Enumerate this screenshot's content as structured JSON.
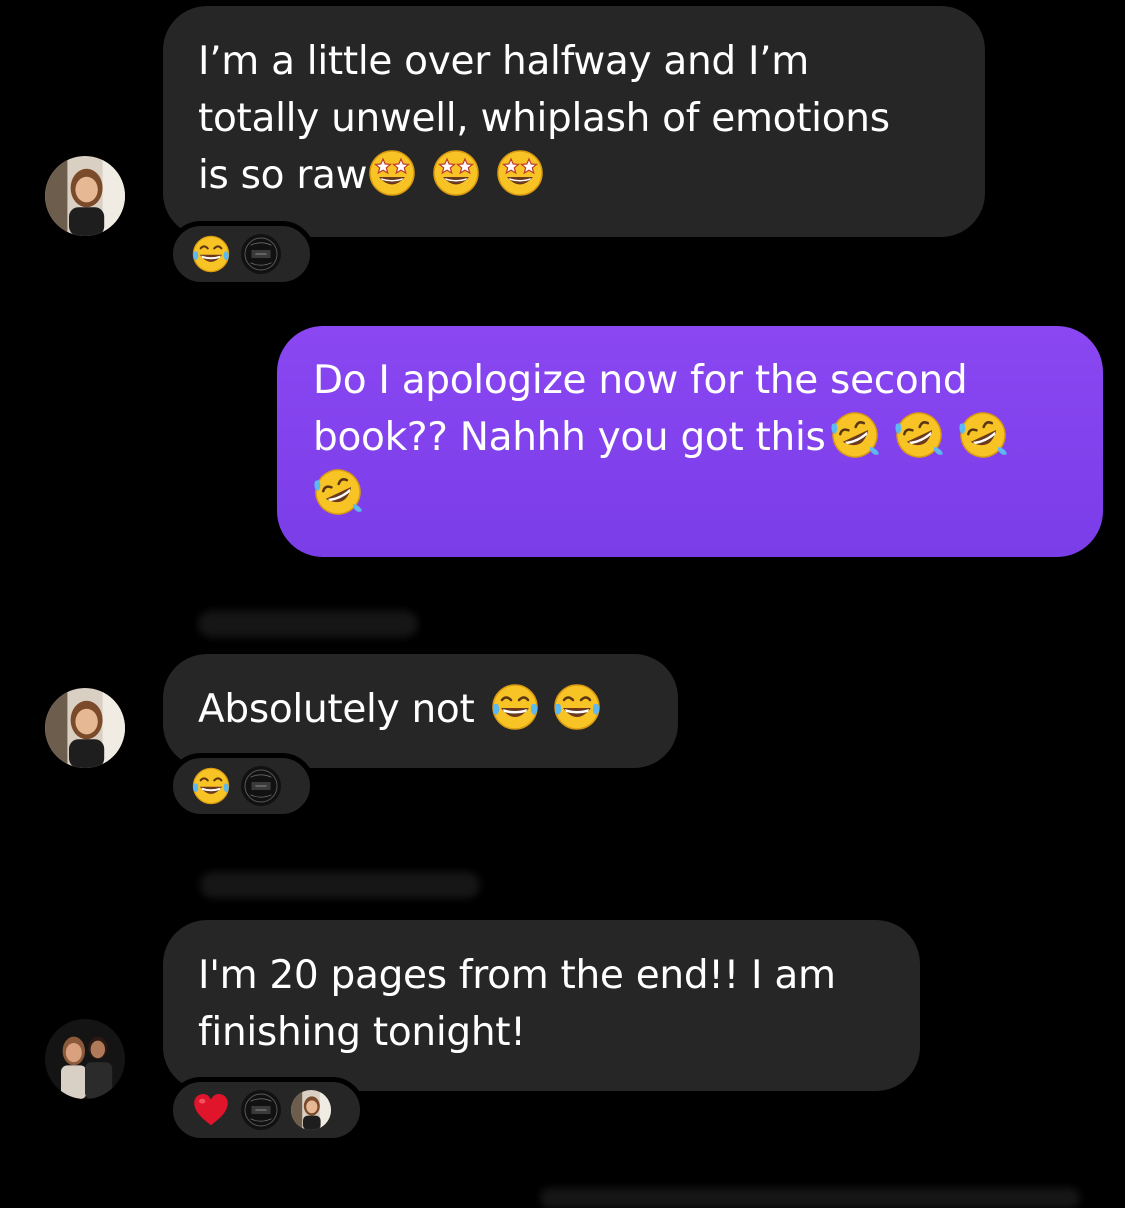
{
  "messages": [
    {
      "sender": "them",
      "text": "I’m a little over halfway and I’m totally unwell, whiplash of emotions is so raw",
      "lines": [
        "I’m a little over halfway and I’m",
        "totally unwell, whiplash of emotions",
        "is so raw"
      ],
      "trailing_emoji": [
        "star-struck",
        "star-struck",
        "star-struck"
      ],
      "reactions": [
        "laughing-tears",
        "profile-photo"
      ]
    },
    {
      "sender": "me",
      "text": "Do I apologize now for the second book?? Nahhh you got this",
      "lines": [
        "Do I apologize now for the second",
        "book?? Nahhh you got this"
      ],
      "trailing_emoji": [
        "rolling-laughing",
        "rolling-laughing",
        "rolling-laughing",
        "rolling-laughing"
      ]
    },
    {
      "sender": "them",
      "text": "Absolutely not",
      "lines": [
        "Absolutely not"
      ],
      "trailing_emoji": [
        "laughing-tears",
        "laughing-tears"
      ],
      "reactions": [
        "laughing-tears",
        "profile-photo"
      ]
    },
    {
      "sender": "them",
      "text": "I'm 20 pages from the end!! I am finishing tonight!",
      "lines": [
        "I'm 20 pages from the end!! I am",
        "finishing tonight!"
      ],
      "reactions": [
        "red-heart",
        "profile-photo",
        "profile-photo"
      ]
    }
  ],
  "colors": {
    "background": "#000000",
    "incoming_bubble": "#262626",
    "outgoing_bubble": "#8a47f2",
    "text": "#ffffff"
  }
}
